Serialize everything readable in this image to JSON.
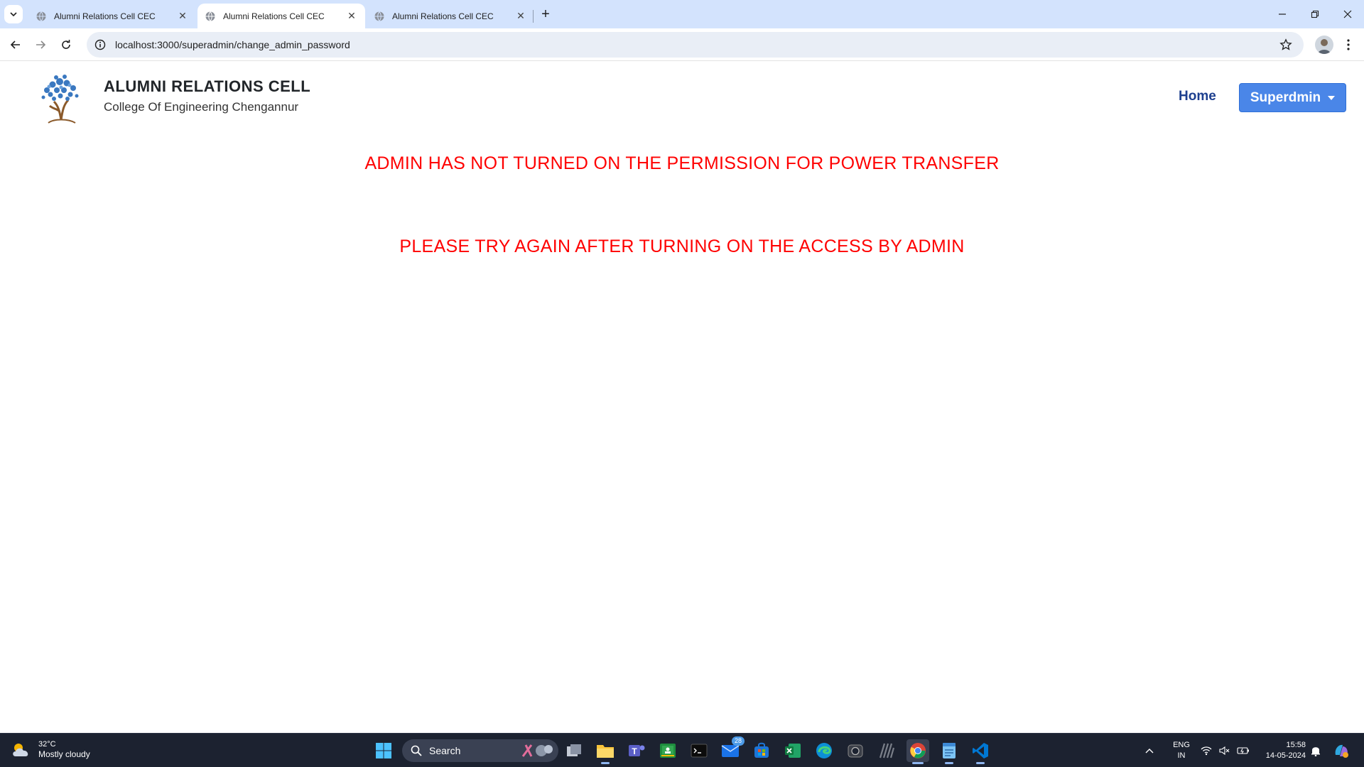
{
  "browser": {
    "tabs": [
      {
        "title": "Alumni Relations Cell CEC",
        "active": false
      },
      {
        "title": "Alumni Relations Cell CEC",
        "active": true
      },
      {
        "title": "Alumni Relations Cell CEC",
        "active": false
      }
    ],
    "url": "localhost:3000/superadmin/change_admin_password"
  },
  "header": {
    "title": "ALUMNI RELATIONS CELL",
    "subtitle": "College Of Engineering Chengannur",
    "nav_home": "Home",
    "nav_dropdown": "Superdmin"
  },
  "messages": {
    "line1": "ADMIN HAS NOT TURNED ON THE PERMISSION FOR POWER TRANSFER",
    "line2": "PLEASE TRY AGAIN AFTER TURNING ON THE ACCESS BY ADMIN"
  },
  "taskbar": {
    "weather_temp": "32°C",
    "weather_cond": "Mostly cloudy",
    "search_label": "Search",
    "mail_badge": "28",
    "lang_line1": "ENG",
    "lang_line2": "IN",
    "time": "15:58",
    "date": "14-05-2024"
  },
  "colors": {
    "message": "#ff0000",
    "nav_home": "#1d3f8f",
    "dropdown_bg": "#4a86e8",
    "tabstrip": "#d3e3fd",
    "taskbar": "#1c2230"
  }
}
